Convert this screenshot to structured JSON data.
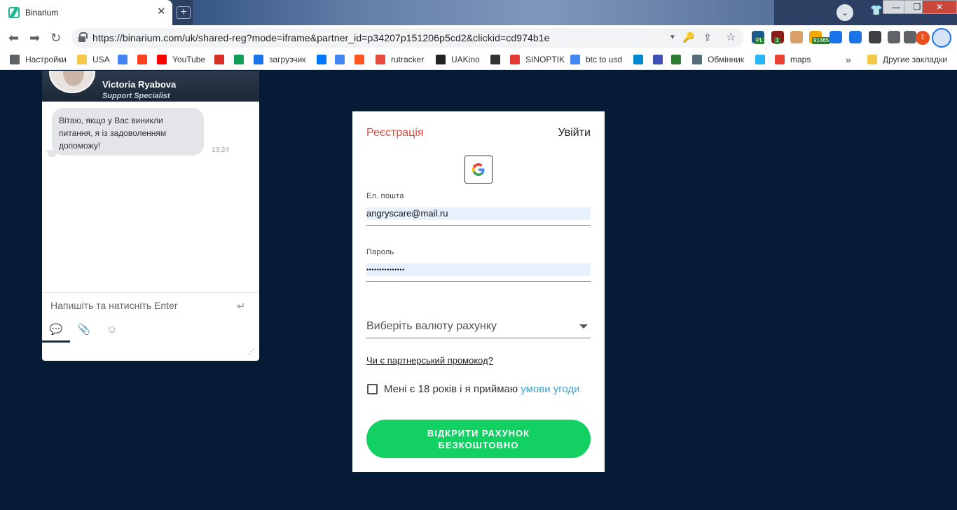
{
  "browser": {
    "tab_title": "Binarium",
    "tab_close": "✕",
    "new_tab": "+",
    "url": "https://binarium.com/uk/shared-reg?mode=iframe&partner_id=p34207p151206p5cd2&clickid=cd974b1e",
    "window_controls": {
      "minimize": "—",
      "maximize": "❐",
      "close": "✕"
    },
    "profile_menu": "⌄",
    "extensions": [
      {
        "icon": "globe-icon",
        "badge": "PL",
        "color": "#1a5a8a"
      },
      {
        "icon": "ublock-icon",
        "badge": "1",
        "color": "#8b1a1a"
      },
      {
        "icon": "pixel-face-icon",
        "badge": "",
        "color": "#d9a066"
      },
      {
        "icon": "bitcoin-icon",
        "badge": "91465",
        "color": "#f2a900"
      },
      {
        "icon": "download-icon",
        "badge": "",
        "color": "#1a73e8"
      },
      {
        "icon": "v-icon",
        "badge": "",
        "color": "#1a73e8"
      },
      {
        "icon": "terminal-icon",
        "badge": "",
        "color": "#3c4043"
      },
      {
        "icon": "puzzle-icon",
        "badge": "",
        "color": "#5f6368"
      },
      {
        "icon": "playlist-icon",
        "badge": "",
        "color": "#5f6368"
      }
    ],
    "notification_count": "1"
  },
  "bookmarks": [
    {
      "label": "Настройки",
      "icon": "gear-icon",
      "color": "#5f6368"
    },
    {
      "label": "USA",
      "icon": "folder-icon",
      "color": "#f4c949"
    },
    {
      "label": "",
      "icon": "google-icon",
      "color": "#4285f4"
    },
    {
      "label": "",
      "icon": "yandex-icon",
      "color": "#fc3f1d"
    },
    {
      "label": "YouTube",
      "icon": "youtube-icon",
      "color": "#ff0000"
    },
    {
      "label": "",
      "icon": "gmail-icon",
      "color": "#d93025"
    },
    {
      "label": "",
      "icon": "drive-icon",
      "color": "#0f9d58"
    },
    {
      "label": "загрузчик",
      "icon": "infinity-icon",
      "color": "#1a73e8"
    },
    {
      "label": "",
      "icon": "vk-icon",
      "color": "#0077ff"
    },
    {
      "label": "",
      "icon": "translate-icon",
      "color": "#4285f4"
    },
    {
      "label": "",
      "icon": "f-icon",
      "color": "#ff5722"
    },
    {
      "label": "rutracker",
      "icon": "star-icon",
      "color": "#e74c3c"
    },
    {
      "label": "UAKino",
      "icon": "film-icon",
      "color": "#222222"
    },
    {
      "label": "",
      "icon": "chess-icon",
      "color": "#333333"
    },
    {
      "label": "SINOPTIK",
      "icon": "thermometer-icon",
      "color": "#e53935"
    },
    {
      "label": "btc to usd",
      "icon": "google-icon",
      "color": "#4285f4"
    },
    {
      "label": "",
      "icon": "p-icon",
      "color": "#0288d1"
    },
    {
      "label": "",
      "icon": "arrow-icon",
      "color": "#3f51b5"
    },
    {
      "label": "",
      "icon": "bc-icon",
      "color": "#2e7d32"
    },
    {
      "label": "Обмінник",
      "icon": "diamond-icon",
      "color": "#546e7a"
    },
    {
      "label": "",
      "icon": "asterisk-icon",
      "color": "#29b6f6"
    },
    {
      "label": "maps",
      "icon": "map-pin-icon",
      "color": "#ea4335"
    }
  ],
  "bookmarks_overflow": "»",
  "other_bookmarks": "Другие закладки",
  "chat": {
    "agent_name": "Victoria Ryabova",
    "agent_role": "Support Specialist",
    "message": "Вітаю, якщо у Вас виникли питання, я із задоволенням допоможу!",
    "message_time": "13:24",
    "input_placeholder": "Напишіть та натисніть Enter"
  },
  "form": {
    "tab_register": "Реєстрація",
    "tab_login": "Увійти",
    "email_label": "Ел. пошта",
    "email_value": "angryscare@mail.ru",
    "password_label": "Пароль",
    "password_value": "•••••••••••••••",
    "currency_placeholder": "Виберіть валюту рахунку",
    "promo_link": "Чи є партнерський промокод?",
    "agree_text": "Мені є 18 років і я приймаю ",
    "agree_link": "умови угоди",
    "submit_line1": "ВІДКРИТИ РАХУНОК",
    "submit_line2": "БЕЗКОШТОВНО",
    "accent_color": "#e04b3c",
    "button_color": "#12d062",
    "link_color": "#3aa1c9"
  }
}
